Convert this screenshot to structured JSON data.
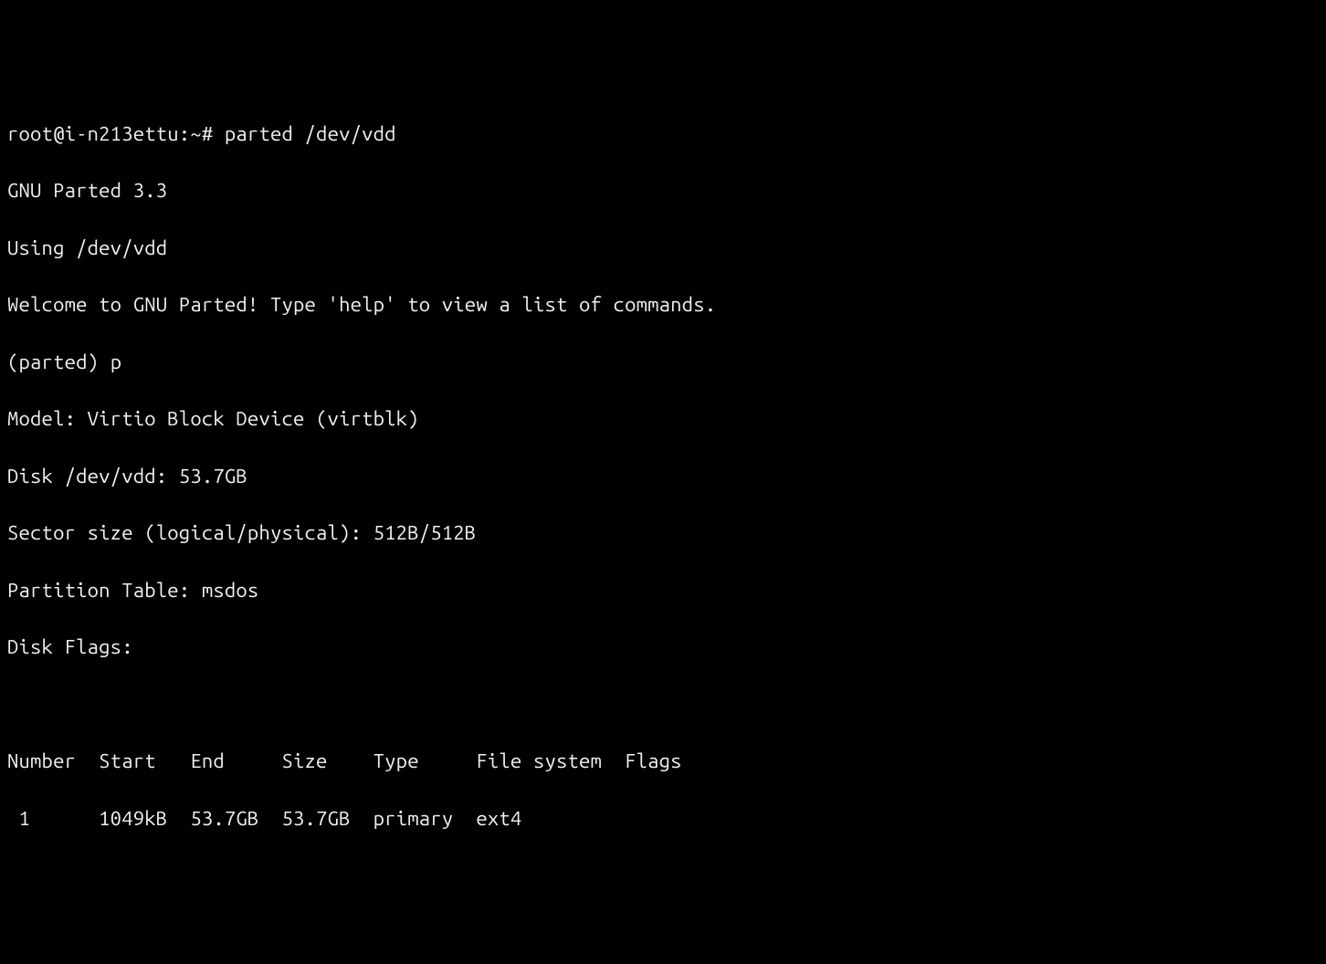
{
  "shell": {
    "prompt": "root@i-n213ettu:~# ",
    "command": "parted /dev/vdd"
  },
  "parted": {
    "version_line": "GNU Parted 3.3",
    "using_line": "Using /dev/vdd",
    "welcome_line": "Welcome to GNU Parted! Type 'help' to view a list of commands.",
    "prompt": "(parted) ",
    "subcommand": "p",
    "model_line": "Model: Virtio Block Device (virtblk)",
    "disk_line": "Disk /dev/vdd: 53.7GB",
    "sector_line": "Sector size (logical/physical): 512B/512B",
    "partition_table_line": "Partition Table: msdos",
    "disk_flags_line": "Disk Flags:"
  },
  "table": {
    "header": "Number  Start   End     Size    Type     File system  Flags",
    "rows": [
      {
        "number": "1",
        "start": "1049kB",
        "end": "53.7GB",
        "size": "53.7GB",
        "type": "primary",
        "file_system": "ext4",
        "flags": "",
        "formatted": " 1      1049kB  53.7GB  53.7GB  primary  ext4"
      }
    ]
  }
}
